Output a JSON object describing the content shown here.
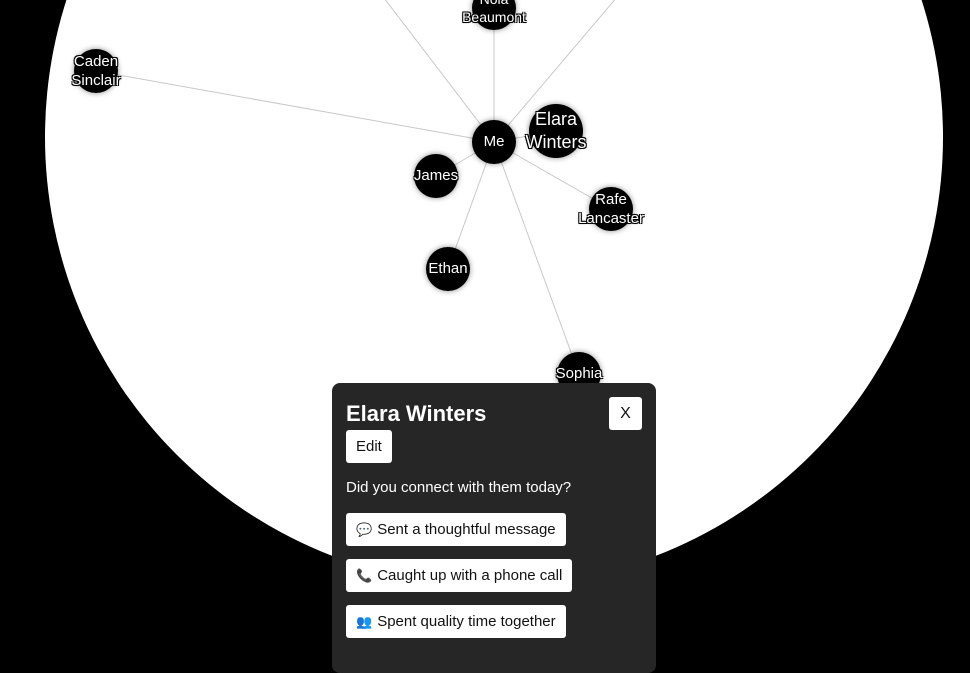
{
  "network": {
    "center": {
      "label": "Me"
    },
    "contacts": [
      {
        "id": "nola",
        "label": "Nola\nBeaumont"
      },
      {
        "id": "caden",
        "label": "Caden\nSinclair"
      },
      {
        "id": "elara",
        "label": "Elara\nWinters"
      },
      {
        "id": "james",
        "label": "James"
      },
      {
        "id": "rafe",
        "label": "Rafe\nLancaster"
      },
      {
        "id": "ethan",
        "label": "Ethan"
      },
      {
        "id": "sophia",
        "label": "Sophia"
      },
      {
        "id": "offscreen-1",
        "label": ""
      },
      {
        "id": "offscreen-2",
        "label": ""
      }
    ]
  },
  "panel": {
    "title": "Elara Winters",
    "close_label": "X",
    "edit_label": "Edit",
    "prompt": "Did you connect with them today?",
    "actions": [
      {
        "icon": "speech-bubble-icon",
        "glyph": "💬",
        "label": "Sent a thoughtful message"
      },
      {
        "icon": "phone-icon",
        "glyph": "📞",
        "label": "Caught up with a phone call"
      },
      {
        "icon": "people-icon",
        "glyph": "👥",
        "label": "Spent quality time together"
      }
    ]
  },
  "colors": {
    "background": "#000000",
    "globe": "#ffffff",
    "node": "#000000",
    "link": "#c8c8c8",
    "panel": "#262626",
    "button": "#ffffff"
  }
}
